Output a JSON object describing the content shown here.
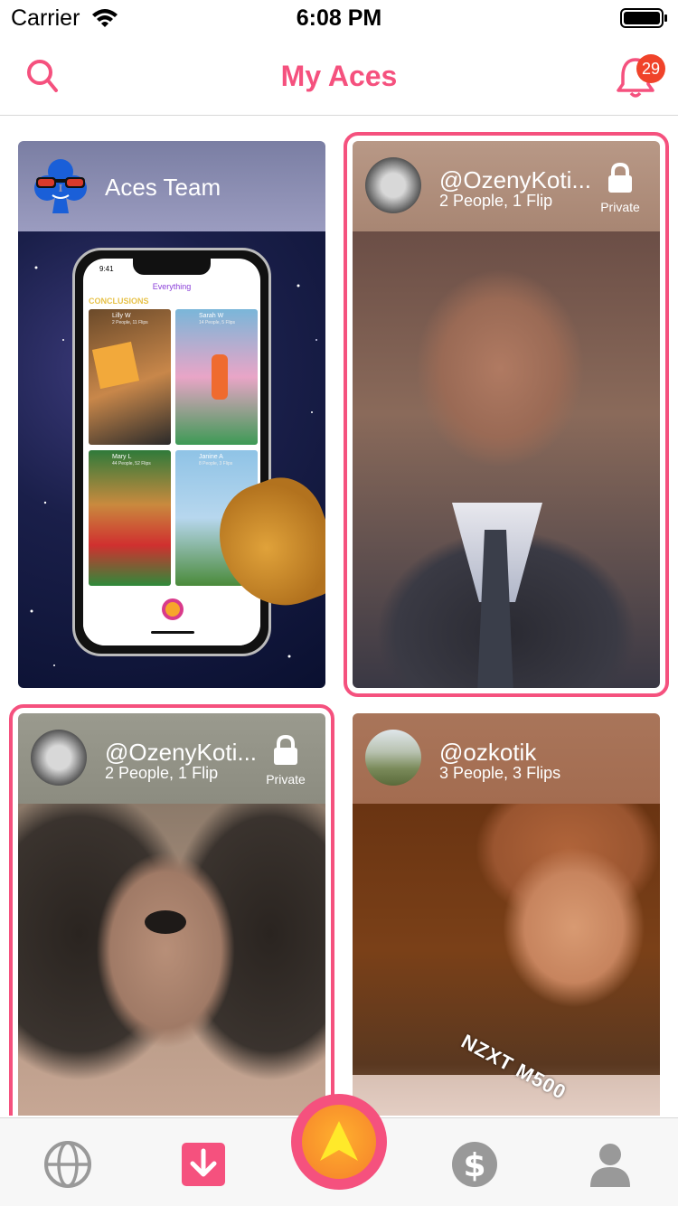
{
  "status_bar": {
    "carrier": "Carrier",
    "time": "6:08 PM"
  },
  "nav": {
    "title": "My Aces",
    "notification_count": "29",
    "search_icon": "search-icon",
    "bell_icon": "bell-icon"
  },
  "colors": {
    "accent": "#f5517e",
    "badge": "#f0432a",
    "fab_orange": "#f79a2b"
  },
  "cards": [
    {
      "title": "Aces Team",
      "subtitle": "",
      "private": false,
      "selected": false,
      "phone_preview": {
        "time": "9:41",
        "header": "Everything",
        "banner": "CONCLUSIONS",
        "items": [
          {
            "name": "Lilly W",
            "meta": "2 People, 11 Flips"
          },
          {
            "name": "Sarah W",
            "meta": "14 People, 5 Flips"
          },
          {
            "name": "Mary L",
            "meta": "44 People, 52 Flips"
          },
          {
            "name": "Janine A",
            "meta": "8 People, 3 Flips"
          }
        ]
      }
    },
    {
      "title": "@OzenyKoti...",
      "subtitle": "2 People, 1 Flip",
      "private": true,
      "private_label": "Private",
      "selected": true
    },
    {
      "title": "@OzenyKoti...",
      "subtitle": "2 People, 1 Flip",
      "private": true,
      "private_label": "Private",
      "selected": true
    },
    {
      "title": "@ozkotik",
      "subtitle": "3 People, 3 Flips",
      "private": false,
      "selected": false,
      "overlay_text": "NZXT M500"
    }
  ],
  "tabs": [
    {
      "icon": "globe-icon"
    },
    {
      "icon": "download-icon",
      "active": true
    },
    {
      "icon": "aces-arrow-icon"
    },
    {
      "icon": "dollar-icon"
    },
    {
      "icon": "profile-icon"
    }
  ]
}
